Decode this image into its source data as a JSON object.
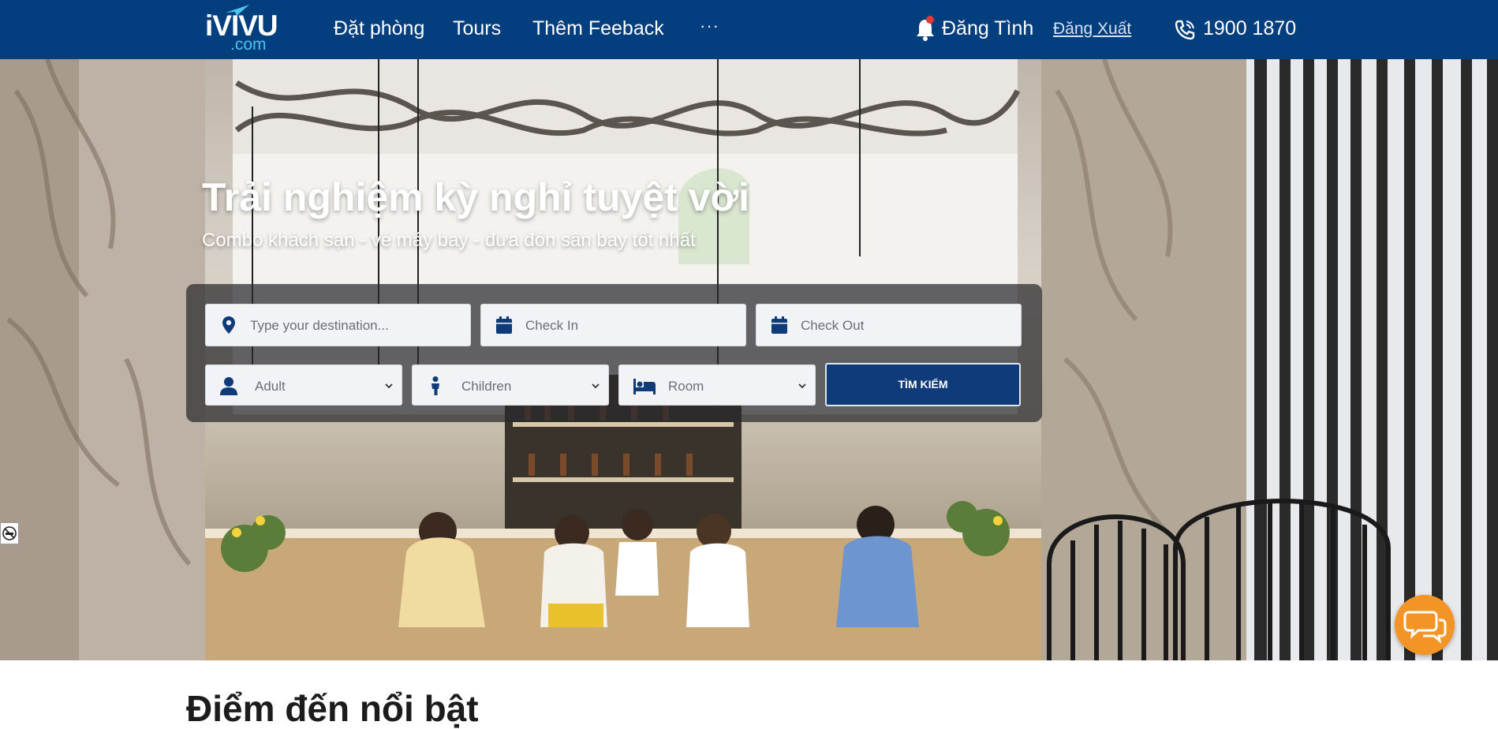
{
  "brand": {
    "logo_main": "iVIVU",
    "logo_sub": ".com"
  },
  "nav": {
    "items": [
      {
        "label": "Đặt phòng"
      },
      {
        "label": "Tours"
      },
      {
        "label": "Thêm Feeback"
      }
    ],
    "more_label": "···",
    "user_name": "Đăng Tình",
    "logout_label": "Đăng Xuất",
    "hotline": "1900 1870"
  },
  "hero": {
    "title": "Trải nghiệm kỳ nghỉ tuyệt vời",
    "subtitle": "Combo khách sạn - vé máy bay - đưa đón sân bay tốt nhất"
  },
  "search": {
    "destination_placeholder": "Type your destination...",
    "checkin_placeholder": "Check In",
    "checkout_placeholder": "Check Out",
    "adult_label": "Adult",
    "children_label": "Children",
    "room_label": "Room",
    "submit_label": "TÌM KIẾM"
  },
  "section": {
    "title_partial": "Ðiểm đến nổi bật"
  },
  "colors": {
    "navbar": "#033e7e",
    "accent_cyan": "#4ec3ee",
    "search_button": "#0f3b79",
    "chat_button": "#f29525"
  },
  "icons": [
    "map-marker-icon",
    "calendar-icon",
    "user-icon",
    "child-icon",
    "bed-icon",
    "bell-icon",
    "phone-icon",
    "chat-icon",
    "no-smoking-icon",
    "chevron-down-icon"
  ]
}
